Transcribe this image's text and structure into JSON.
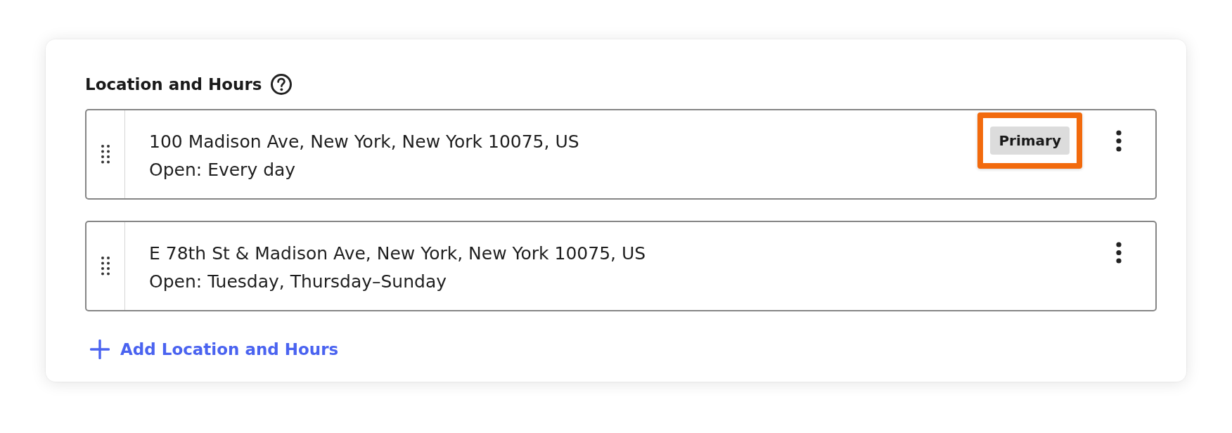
{
  "section": {
    "title": "Location and Hours"
  },
  "locations": [
    {
      "address": "100 Madison Ave, New York, New York 10075, US",
      "hours": "Open: Every day",
      "badge": {
        "label": "Primary",
        "highlighted": true
      }
    },
    {
      "address": "E 78th St & Madison Ave, New York, New York 10075, US",
      "hours": "Open: Tuesday, Thursday–Sunday"
    }
  ],
  "add_button": {
    "label": "Add Location and Hours"
  }
}
